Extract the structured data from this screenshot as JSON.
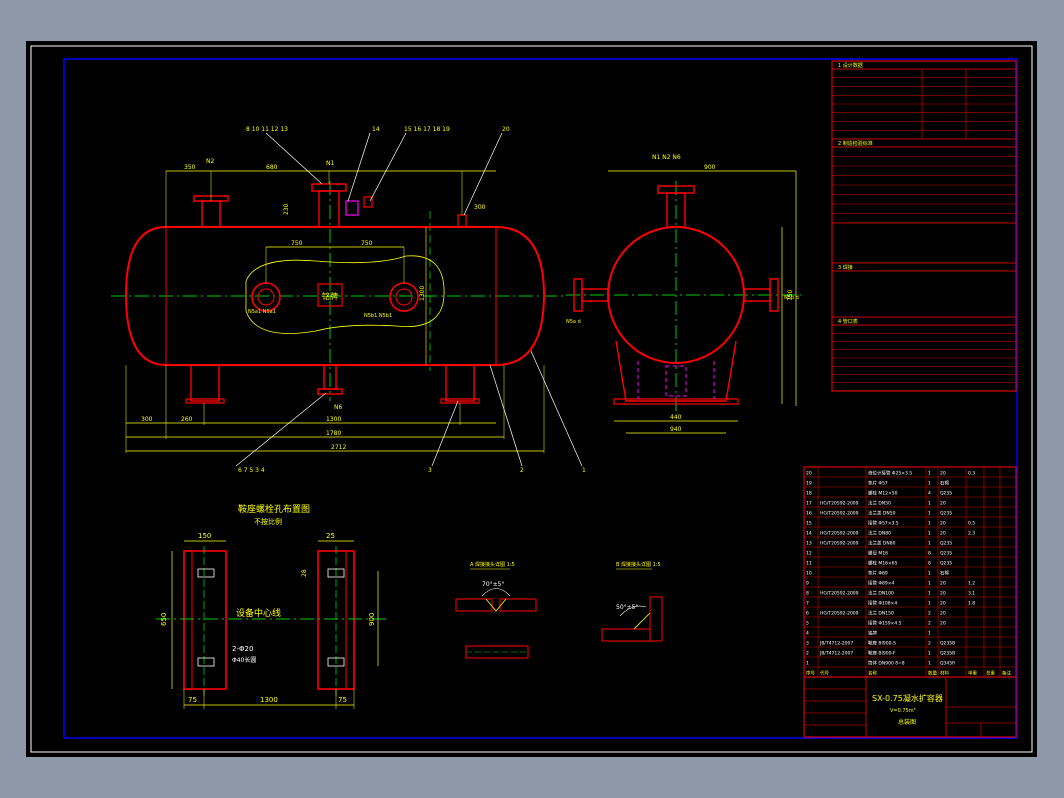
{
  "colors": {
    "background": "#000000",
    "outline": "#ff0000",
    "dimension": "#ffff00",
    "centerline": "#00cc00",
    "leader": "#ffffff",
    "hidden": "#ff00ff",
    "frame": "#0000ff"
  },
  "main_view": {
    "part_callouts_top": [
      "8 10 11 12 13",
      "14",
      "15 16 17 18 19",
      "20"
    ],
    "part_callouts_bottom": [
      "6 7 5 3 4",
      "3",
      "2",
      "1"
    ],
    "nozzle_labels": [
      "N2",
      "N1",
      "N6",
      "N5a1 N5a1",
      "N5b1 N5b1"
    ],
    "nameplate": "铭牌",
    "dims_top": [
      "350",
      "680",
      "300"
    ],
    "dims_inner": [
      "750",
      "750"
    ],
    "dims_bottom": [
      "300",
      "260",
      "1300",
      "1780",
      "2712"
    ],
    "dims_vertical": [
      "230",
      "1300"
    ]
  },
  "side_view": {
    "nozzle_labels": "N1 N2 N6",
    "dims": [
      "900",
      "750",
      "440",
      "940"
    ],
    "side_labels": [
      "N5a d",
      "N5b d"
    ]
  },
  "details": {
    "support_title": "鞍座螺栓孔布置图",
    "support_scale": "不按比例",
    "dims": [
      "150",
      "25",
      "28",
      "650",
      "900",
      "75",
      "1300",
      "75"
    ],
    "center_label": "设备中心线",
    "hole_label": "2-Φ20",
    "hole_note": "Φ40长圆",
    "weld_a_title": "A 焊接接头详图 1:5",
    "weld_b_title": "B 焊接接头详图 1:5",
    "weld_a_angle": "70°±5°",
    "weld_b_angle": "50°±5°"
  },
  "title_block": {
    "main_title": "SX-0.75凝水扩容器",
    "sub_title": "V=0.75m³",
    "drawing_label": "总装图"
  },
  "design_table": {
    "section_titles": [
      "1 设计数据",
      "2 制造检验标准",
      "3 焊接",
      "4 管口表"
    ]
  },
  "parts_list": {
    "header": [
      "序号",
      "代号",
      "名称",
      "数量",
      "材料",
      "单重",
      "总重",
      "备注"
    ],
    "rows": [
      [
        "20",
        "",
        "液位计接管 Φ25×3.5",
        "1",
        "20",
        "0.3",
        ""
      ],
      [
        "19",
        "",
        "垫片 Φ57",
        "1",
        "石棉",
        "",
        ""
      ],
      [
        "18",
        "",
        "螺栓 M12×50",
        "4",
        "Q235",
        "",
        ""
      ],
      [
        "17",
        "HG/T20592-2009",
        "法兰 DN50",
        "1",
        "20",
        "",
        ""
      ],
      [
        "16",
        "HG/T20592-2009",
        "法兰盖 DN50",
        "1",
        "Q235",
        "",
        ""
      ],
      [
        "15",
        "",
        "接管 Φ57×3.5",
        "1",
        "20",
        "0.5",
        ""
      ],
      [
        "14",
        "HG/T20592-2009",
        "法兰 DN80",
        "1",
        "20",
        "2.3",
        ""
      ],
      [
        "13",
        "HG/T20592-2009",
        "法兰盖 DN80",
        "1",
        "Q235",
        "",
        ""
      ],
      [
        "12",
        "",
        "螺母 M16",
        "8",
        "Q235",
        "",
        ""
      ],
      [
        "11",
        "",
        "螺栓 M16×65",
        "8",
        "Q235",
        "",
        ""
      ],
      [
        "10",
        "",
        "垫片 Φ89",
        "1",
        "石棉",
        "",
        ""
      ],
      [
        "9",
        "",
        "接管 Φ89×4",
        "1",
        "20",
        "1.2",
        ""
      ],
      [
        "8",
        "HG/T20592-2009",
        "法兰 DN100",
        "1",
        "20",
        "3.1",
        ""
      ],
      [
        "7",
        "",
        "接管 Φ108×4",
        "1",
        "20",
        "1.8",
        ""
      ],
      [
        "6",
        "HG/T20592-2009",
        "法兰 DN150",
        "2",
        "20",
        "",
        ""
      ],
      [
        "5",
        "",
        "接管 Φ159×4.5",
        "2",
        "20",
        "",
        ""
      ],
      [
        "4",
        "",
        "铭牌",
        "1",
        "",
        "",
        ""
      ],
      [
        "3",
        "JB/T4712-2007",
        "鞍座 BI900-S",
        "2",
        "Q235B",
        "",
        ""
      ],
      [
        "2",
        "JB/T4712-2007",
        "鞍座 BI900-F",
        "1",
        "Q235B",
        "",
        ""
      ],
      [
        "1",
        "",
        "筒体 DN900 δ=8",
        "1",
        "Q345R",
        "",
        ""
      ]
    ]
  }
}
